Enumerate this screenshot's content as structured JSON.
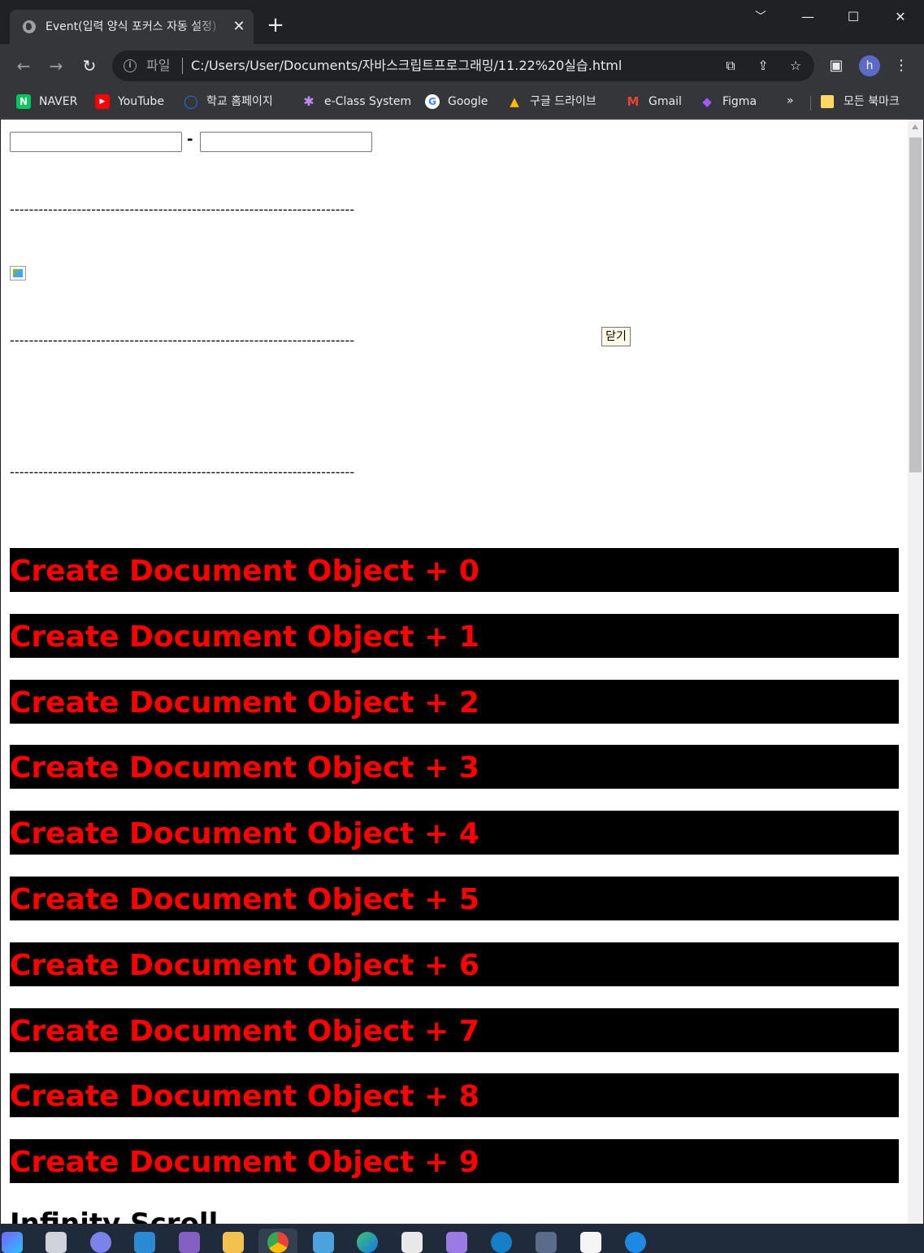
{
  "browser": {
    "tab_title": "Event(입력 양식 포커스 자동 설정)",
    "close_glyph": "✕",
    "new_tab_glyph": "+",
    "window_controls": [
      "﹀",
      "—",
      "☐",
      "✕"
    ],
    "nav": {
      "back": "←",
      "forward": "→",
      "reload": "↻"
    },
    "url_scheme_label": "파일",
    "url": "C:/Users/User/Documents/자바스크립트프로그래밍/11.22%20실습.html",
    "avatar_letter": "h",
    "bookmarks": [
      {
        "label": "NAVER",
        "icon": "naver-icon",
        "color": "#03c75a",
        "glyph": "N"
      },
      {
        "label": "YouTube",
        "icon": "youtube-icon",
        "color": "#ff0000",
        "glyph": "▶"
      },
      {
        "label": "학교 홈페이지",
        "icon": "school-icon",
        "color": "#1a73e8",
        "glyph": "◯"
      },
      {
        "label": "e-Class System",
        "icon": "eclass-icon",
        "color": "#8e24aa",
        "glyph": "✱"
      },
      {
        "label": "Google",
        "icon": "google-icon",
        "color": "#ffffff",
        "glyph": "G"
      },
      {
        "label": "구글 드라이브",
        "icon": "drive-icon",
        "color": "#fbbc04",
        "glyph": "▲"
      },
      {
        "label": "Gmail",
        "icon": "gmail-icon",
        "color": "#ea4335",
        "glyph": "M"
      },
      {
        "label": "Figma",
        "icon": "figma-icon",
        "color": "#a259ff",
        "glyph": "◆"
      }
    ],
    "bookmarks_more": "»",
    "all_bookmarks_label": "모든 북마크"
  },
  "page": {
    "separator_text": "------------------------------------------------------------------------",
    "hyphen": "-",
    "close_button_label": "닫기",
    "created_items": [
      "Create Document Object + 0",
      "Create Document Object + 1",
      "Create Document Object + 2",
      "Create Document Object + 3",
      "Create Document Object + 4",
      "Create Document Object + 5",
      "Create Document Object + 6",
      "Create Document Object + 7",
      "Create Document Object + 8",
      "Create Document Object + 9"
    ],
    "created_item_colors": {
      "text": "#ff0000",
      "background": "#000000"
    },
    "infinity_heading": "Infinity Scroll"
  },
  "taskbar": {
    "apps": [
      "copilot-icon",
      "files-icon",
      "teams-icon",
      "vscode-icon",
      "visual-studio-icon",
      "explorer-icon",
      "chrome-icon",
      "notepad-icon",
      "edge-icon",
      "store-icon",
      "calendar-icon",
      "media-icon",
      "clipboard-icon",
      "paint-icon",
      "bluetooth-icon"
    ]
  }
}
